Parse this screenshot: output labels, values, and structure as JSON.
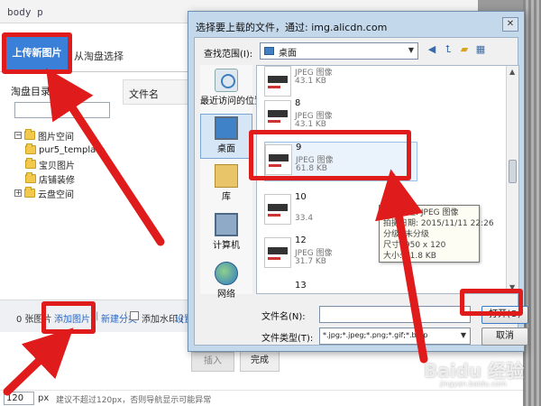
{
  "page": {
    "breadcrumb": "body  p",
    "upload_tab": "上传新图片",
    "taobao_tab": "从淘盘选择",
    "directory_title": "淘盘目录",
    "tree": {
      "root": "图片空间",
      "children": [
        "pur5_template",
        "宝贝图片",
        "店铺装修"
      ],
      "cloud": "云盘空间"
    },
    "filelist_header": "文件名",
    "bottom_bar": {
      "count": "0 张图片",
      "add_image": "添加图片",
      "separator": "|",
      "new_category": "新建分类",
      "add_watermark": "添加水印 (",
      "watermark_settings": "设置"
    },
    "insert_button": "插入",
    "done_button": "完成",
    "width_value": "120",
    "width_unit": "px",
    "width_hint": "建议不超过120px，否则导航显示可能异常"
  },
  "dialog": {
    "title": "选择要上载的文件，通过: img.alicdn.com",
    "close_glyph": "✕",
    "look_in_label": "查找范围(I):",
    "look_in_value": "桌面",
    "nav_icons": [
      "back-icon",
      "up-folder-icon",
      "new-folder-icon",
      "view-menu-icon"
    ],
    "places": [
      {
        "label": "最近访问的位置",
        "icon": "recent-places-icon"
      },
      {
        "label": "桌面",
        "icon": "desktop-icon"
      },
      {
        "label": "库",
        "icon": "library-icon"
      },
      {
        "label": "计算机",
        "icon": "computer-icon"
      },
      {
        "label": "网络",
        "icon": "network-icon"
      }
    ],
    "files": [
      {
        "name": "",
        "type": "JPEG 图像",
        "size": "43.1 KB"
      },
      {
        "name": "8",
        "type": "JPEG 图像",
        "size": "43.1 KB"
      },
      {
        "name": "9",
        "type": "JPEG 图像",
        "size": "61.8 KB"
      },
      {
        "name": "10",
        "type": "",
        "size": "33.4"
      },
      {
        "name": "12",
        "type": "JPEG 图像",
        "size": "31.7 KB"
      },
      {
        "name": "13",
        "type": "",
        "size": ""
      }
    ],
    "tooltip": {
      "type": "项目类型: JPEG 图像",
      "date": "拍摄日期: 2015/11/11 22:26",
      "rating": "分级: 未分级",
      "dimensions": "尺寸: 950 x 120",
      "size": "大小: 61.8 KB"
    },
    "file_name_label": "文件名(N):",
    "file_name_value": "",
    "file_type_label": "文件类型(T):",
    "file_type_value": "*.jpg;*.jpeg;*.png;*.gif;*.bmp",
    "open_button": "打开(O)",
    "cancel_button": "取消"
  },
  "watermark": {
    "text": "Baidu 经验",
    "sub": "jingyan.baidu.com"
  },
  "colors": {
    "annotation_red": "#e01b1b",
    "upload_blue": "#3a80d8",
    "link_blue": "#2b67c4",
    "dialog_frame": "#c4d8ec"
  }
}
